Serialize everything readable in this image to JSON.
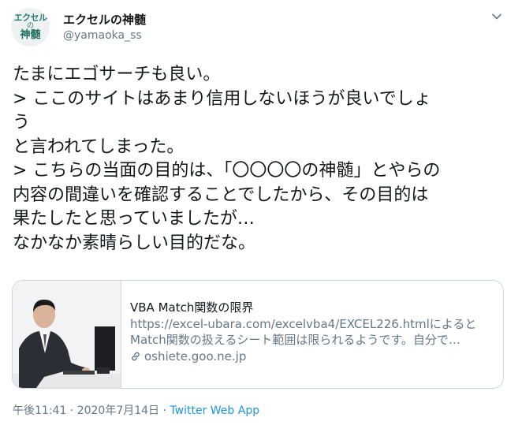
{
  "user": {
    "avatar_text": [
      "エクセル",
      "の",
      "神髄"
    ],
    "name": "エクセルの神髄",
    "handle": "@yamaoka_ss"
  },
  "tweet": {
    "text": "たまにエゴサーチも良い。\n> ここのサイトはあまり信用しないほうが良いでしょ\nう\nと言われてしまった。\n> こちらの当面の目的は、「〇〇〇〇の神髄」とやらの\n内容の間違いを確認することでしたから、その目的は\n果たしたと思っていましたが…\nなかなか素晴らしい目的だな。"
  },
  "card": {
    "title": "VBA Match関数の限界",
    "description": "https://excel-ubara.com/excelvba4/EXCEL226.htmlによると Match関数の扱えるシート範囲は限られるようです。自分で…",
    "domain": "oshiete.goo.ne.jp",
    "image": "man-typing-at-computer-photo"
  },
  "meta": {
    "timestamp": "午後11:41 · 2020年7月14日",
    "separator": " · ",
    "app": "Twitter Web App"
  },
  "icons": {
    "menu": "chevron-down-icon",
    "link": "link-icon"
  },
  "colors": {
    "link_blue": "#1b95e0",
    "muted_gray": "#657786",
    "border": "#ccd6dd"
  }
}
